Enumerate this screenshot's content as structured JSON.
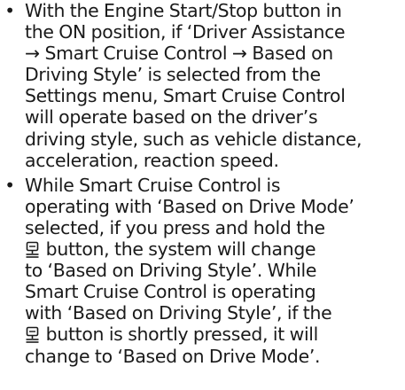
{
  "bullet_symbol": "•",
  "button_icon": "driving-style-button-icon",
  "paragraphs": [
    {
      "lines": [
        "With the Engine Start/Stop button in",
        "the ON position, if ‘Driver Assistance",
        "→ Smart Cruise Control → Based on",
        "Driving Style’ is selected from the",
        "Settings menu, Smart Cruise Control",
        "will operate based on the driver’s",
        "driving style, such as vehicle distance,",
        "acceleration, reaction speed."
      ]
    },
    {
      "lines": [
        "While Smart Cruise Control is",
        "operating with ‘Based on Drive Mode’",
        "selected, if you press and hold the",
        " button, the system will change",
        "to ‘Based on Driving Style’. While",
        "Smart Cruise Control is operating",
        "with ‘Based on Driving Style’, if the",
        " button is shortly pressed, it will",
        "change to ‘Based on Drive Mode’."
      ]
    }
  ]
}
